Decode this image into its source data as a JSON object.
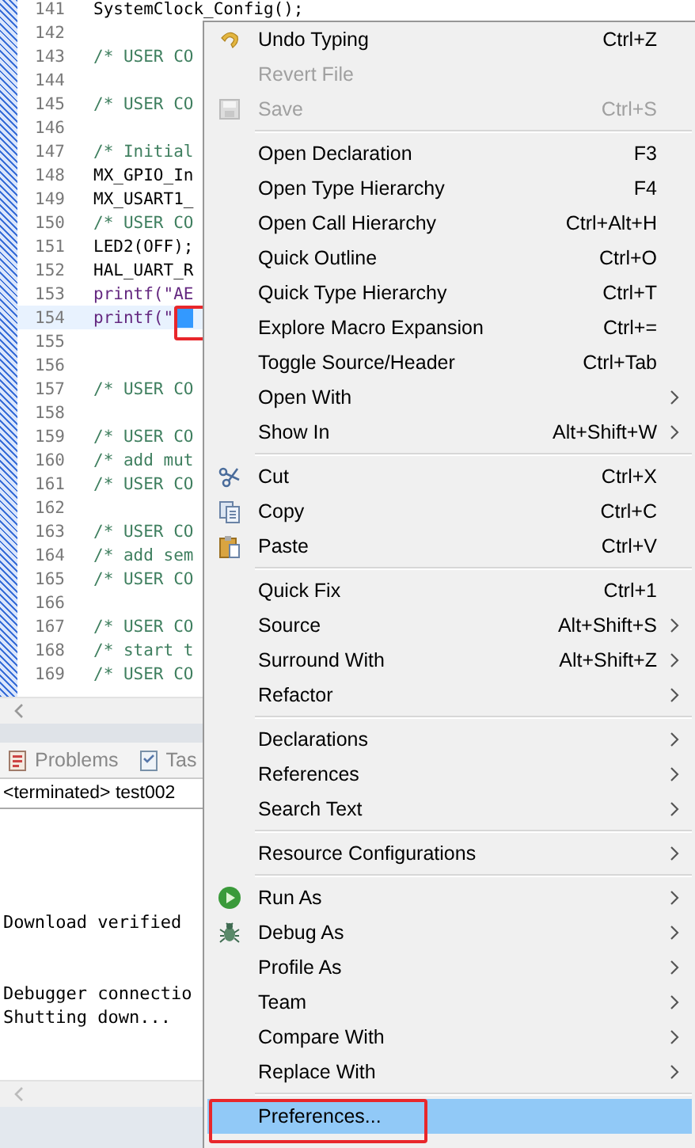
{
  "editor": {
    "lines": [
      {
        "number": "141",
        "code": "SystemClock_Config();",
        "kind": "code",
        "current": false
      },
      {
        "number": "142",
        "current": false
      },
      {
        "number": "143",
        "code": "/* USER CO",
        "kind": "comment",
        "current": false
      },
      {
        "number": "144",
        "current": false
      },
      {
        "number": "145",
        "code": "/* USER CO",
        "kind": "comment",
        "current": false
      },
      {
        "number": "146",
        "current": false
      },
      {
        "number": "147",
        "code": "/* Initial",
        "kind": "comment",
        "current": false
      },
      {
        "number": "148",
        "code": "MX_GPIO_In",
        "kind": "code",
        "current": false
      },
      {
        "number": "149",
        "code": "MX_USART1_",
        "kind": "code",
        "current": false
      },
      {
        "number": "150",
        "code": "/* USER CO",
        "kind": "comment",
        "current": false
      },
      {
        "number": "151",
        "code": "LED2(OFF);",
        "kind": "code",
        "current": false
      },
      {
        "number": "152",
        "code": "HAL_UART_R",
        "kind": "code",
        "current": false
      },
      {
        "number": "153",
        "code": "printf(\"AE",
        "kind": "call",
        "current": false
      },
      {
        "number": "154",
        "code": "printf(\"",
        "kind": "call",
        "current": true
      },
      {
        "number": "155",
        "current": false
      },
      {
        "number": "156",
        "current": false
      },
      {
        "number": "157",
        "code": "/* USER CO",
        "kind": "comment",
        "current": false
      },
      {
        "number": "158",
        "current": false
      },
      {
        "number": "159",
        "code": "/* USER CO",
        "kind": "comment",
        "current": false
      },
      {
        "number": "160",
        "code": "/* add mut",
        "kind": "comment",
        "current": false
      },
      {
        "number": "161",
        "code": "/* USER CO",
        "kind": "comment",
        "current": false
      },
      {
        "number": "162",
        "current": false
      },
      {
        "number": "163",
        "code": "/* USER CO",
        "kind": "comment",
        "current": false
      },
      {
        "number": "164",
        "code": "/* add sem",
        "kind": "comment",
        "current": false
      },
      {
        "number": "165",
        "code": "/* USER CO",
        "kind": "comment",
        "current": false
      },
      {
        "number": "166",
        "current": false
      },
      {
        "number": "167",
        "code": "/* USER CO",
        "kind": "comment",
        "current": false
      },
      {
        "number": "168",
        "code": "/* start t",
        "kind": "comment",
        "current": false
      },
      {
        "number": "169",
        "code": "/* USER CO",
        "kind": "comment",
        "current": false
      }
    ]
  },
  "tabs": [
    {
      "label": "Problems",
      "selected": false
    },
    {
      "label": "Tas",
      "selected": false
    }
  ],
  "console": {
    "header": "<terminated> test002",
    "groups": [
      [
        "Download verified"
      ],
      [
        "Debugger connectio",
        "Shutting down..."
      ]
    ]
  },
  "menu": {
    "items": [
      {
        "kind": "item",
        "label": "Undo Typing",
        "shortcut": "Ctrl+Z",
        "disabled": false,
        "submenu": false,
        "selected": false
      },
      {
        "kind": "item",
        "label": "Revert File",
        "disabled": true,
        "submenu": false,
        "selected": false
      },
      {
        "kind": "item",
        "label": "Save",
        "shortcut": "Ctrl+S",
        "disabled": true,
        "submenu": false,
        "selected": false
      },
      {
        "kind": "separator"
      },
      {
        "kind": "item",
        "label": "Open Declaration",
        "shortcut": "F3",
        "disabled": false,
        "submenu": false,
        "selected": false
      },
      {
        "kind": "item",
        "label": "Open Type Hierarchy",
        "shortcut": "F4",
        "disabled": false,
        "submenu": false,
        "selected": false
      },
      {
        "kind": "item",
        "label": "Open Call Hierarchy",
        "shortcut": "Ctrl+Alt+H",
        "disabled": false,
        "submenu": false,
        "selected": false
      },
      {
        "kind": "item",
        "label": "Quick Outline",
        "shortcut": "Ctrl+O",
        "disabled": false,
        "submenu": false,
        "selected": false
      },
      {
        "kind": "item",
        "label": "Quick Type Hierarchy",
        "shortcut": "Ctrl+T",
        "disabled": false,
        "submenu": false,
        "selected": false
      },
      {
        "kind": "item",
        "label": "Explore Macro Expansion",
        "shortcut": "Ctrl+=",
        "disabled": false,
        "submenu": false,
        "selected": false
      },
      {
        "kind": "item",
        "label": "Toggle Source/Header",
        "shortcut": "Ctrl+Tab",
        "disabled": false,
        "submenu": false,
        "selected": false
      },
      {
        "kind": "item",
        "label": "Open With",
        "disabled": false,
        "submenu": true,
        "selected": false
      },
      {
        "kind": "item",
        "label": "Show In",
        "shortcut": "Alt+Shift+W",
        "disabled": false,
        "submenu": true,
        "selected": false
      },
      {
        "kind": "separator"
      },
      {
        "kind": "item",
        "label": "Cut",
        "shortcut": "Ctrl+X",
        "disabled": false,
        "submenu": false,
        "selected": false
      },
      {
        "kind": "item",
        "label": "Copy",
        "shortcut": "Ctrl+C",
        "disabled": false,
        "submenu": false,
        "selected": false
      },
      {
        "kind": "item",
        "label": "Paste",
        "shortcut": "Ctrl+V",
        "disabled": false,
        "submenu": false,
        "selected": false
      },
      {
        "kind": "separator"
      },
      {
        "kind": "item",
        "label": "Quick Fix",
        "shortcut": "Ctrl+1",
        "disabled": false,
        "submenu": false,
        "selected": false
      },
      {
        "kind": "item",
        "label": "Source",
        "shortcut": "Alt+Shift+S",
        "disabled": false,
        "submenu": true,
        "selected": false
      },
      {
        "kind": "item",
        "label": "Surround With",
        "shortcut": "Alt+Shift+Z",
        "disabled": false,
        "submenu": true,
        "selected": false
      },
      {
        "kind": "item",
        "label": "Refactor",
        "disabled": false,
        "submenu": true,
        "selected": false
      },
      {
        "kind": "separator"
      },
      {
        "kind": "item",
        "label": "Declarations",
        "disabled": false,
        "submenu": true,
        "selected": false
      },
      {
        "kind": "item",
        "label": "References",
        "disabled": false,
        "submenu": true,
        "selected": false
      },
      {
        "kind": "item",
        "label": "Search Text",
        "disabled": false,
        "submenu": true,
        "selected": false
      },
      {
        "kind": "separator"
      },
      {
        "kind": "item",
        "label": "Resource Configurations",
        "disabled": false,
        "submenu": true,
        "selected": false
      },
      {
        "kind": "separator"
      },
      {
        "kind": "item",
        "label": "Run As",
        "disabled": false,
        "submenu": true,
        "selected": false
      },
      {
        "kind": "item",
        "label": "Debug As",
        "disabled": false,
        "submenu": true,
        "selected": false
      },
      {
        "kind": "item",
        "label": "Profile As",
        "disabled": false,
        "submenu": true,
        "selected": false
      },
      {
        "kind": "item",
        "label": "Team",
        "disabled": false,
        "submenu": true,
        "selected": false
      },
      {
        "kind": "item",
        "label": "Compare With",
        "disabled": false,
        "submenu": true,
        "selected": false
      },
      {
        "kind": "item",
        "label": "Replace With",
        "disabled": false,
        "submenu": true,
        "selected": false
      },
      {
        "kind": "separator"
      },
      {
        "kind": "item",
        "label": "Preferences...",
        "disabled": false,
        "submenu": false,
        "selected": true
      }
    ]
  }
}
